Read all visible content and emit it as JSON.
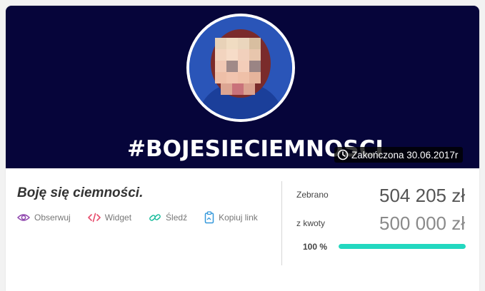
{
  "campaign": {
    "hashtag": "#BOJESIECIEMNOSCI",
    "status_text": "Zakończona 30.06.2017r",
    "title": "Boję się ciemności."
  },
  "actions": [
    {
      "label": "Obserwuj",
      "icon": "eye-icon",
      "color": "#8e44ad"
    },
    {
      "label": "Widget",
      "icon": "code-icon",
      "color": "#e74c6c"
    },
    {
      "label": "Śledź",
      "icon": "link-icon",
      "color": "#1abc9c"
    },
    {
      "label": "Kopiuj link",
      "icon": "clipboard-icon",
      "color": "#3498db"
    }
  ],
  "stats": {
    "raised_label": "Zebrano",
    "raised_value": "504 205 zł",
    "goal_label": "z kwoty",
    "goal_value": "500 000 zł",
    "percent_text": "100 %",
    "progress_fraction": 1.0
  },
  "colors": {
    "banner_bg": "#06053a",
    "progress_fill": "#22d8c0"
  }
}
